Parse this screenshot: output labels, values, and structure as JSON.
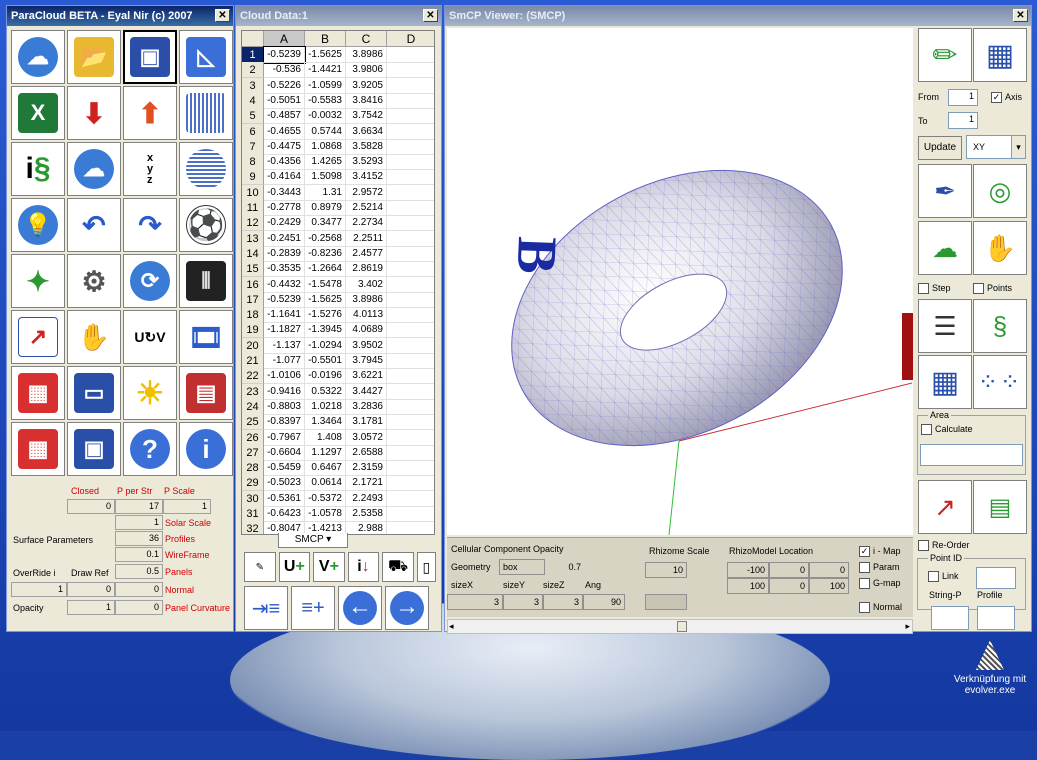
{
  "paracloud": {
    "title": "ParaCloud BETA  -  Eyal Nir (c) 2007",
    "params": {
      "closed_label": "Closed",
      "pperstr_label": "P per Str",
      "pscale_label": "P Scale",
      "closed_value": "0",
      "pperstr_value": "17",
      "pscale_value": "1",
      "surface_params_label": "Surface Parameters",
      "solar_scale_value": "1",
      "solar_scale_label": "Solar Scale",
      "profiles_value": "36",
      "profiles_label": "Profiles",
      "wireframe_value": "0.1",
      "wireframe_label": "WireFrame",
      "override_label": "OverRide i",
      "drawref_label": "Draw Ref",
      "panels_value": "0.5",
      "panels_label": "Panels",
      "override_value": "1",
      "drawref_value": "0",
      "normal_value": "0",
      "normal_label": "Normal",
      "opacity_label": "Opacity",
      "opacity_value": "1",
      "panelcurv_value": "0",
      "panelcurv_label": "Panel Curvature"
    }
  },
  "cloud": {
    "title": "Cloud Data:1",
    "columns": [
      "A",
      "B",
      "C",
      "D"
    ],
    "sheet_tab": "SMCP",
    "rows": [
      [
        "1",
        "-0.5239",
        "-1.5625",
        "3.8986"
      ],
      [
        "2",
        "-0.536",
        "-1.4421",
        "3.9806"
      ],
      [
        "3",
        "-0.5226",
        "-1.0599",
        "3.9205"
      ],
      [
        "4",
        "-0.5051",
        "-0.5583",
        "3.8416"
      ],
      [
        "5",
        "-0.4857",
        "-0.0032",
        "3.7542"
      ],
      [
        "6",
        "-0.4655",
        "0.5744",
        "3.6634"
      ],
      [
        "7",
        "-0.4475",
        "1.0868",
        "3.5828"
      ],
      [
        "8",
        "-0.4356",
        "1.4265",
        "3.5293"
      ],
      [
        "9",
        "-0.4164",
        "1.5098",
        "3.4152"
      ],
      [
        "10",
        "-0.3443",
        "1.31",
        "2.9572"
      ],
      [
        "11",
        "-0.2778",
        "0.8979",
        "2.5214"
      ],
      [
        "12",
        "-0.2429",
        "0.3477",
        "2.2734"
      ],
      [
        "13",
        "-0.2451",
        "-0.2568",
        "2.2511"
      ],
      [
        "14",
        "-0.2839",
        "-0.8236",
        "2.4577"
      ],
      [
        "15",
        "-0.3535",
        "-1.2664",
        "2.8619"
      ],
      [
        "16",
        "-0.4432",
        "-1.5478",
        "3.402"
      ],
      [
        "17",
        "-0.5239",
        "-1.5625",
        "3.8986"
      ],
      [
        "18",
        "-1.1641",
        "-1.5276",
        "4.0113"
      ],
      [
        "19",
        "-1.1827",
        "-1.3945",
        "4.0689"
      ],
      [
        "20",
        "-1.137",
        "-1.0294",
        "3.9502"
      ],
      [
        "21",
        "-1.077",
        "-0.5501",
        "3.7945"
      ],
      [
        "22",
        "-1.0106",
        "-0.0196",
        "3.6221"
      ],
      [
        "23",
        "-0.9416",
        "0.5322",
        "3.4427"
      ],
      [
        "24",
        "-0.8803",
        "1.0218",
        "3.2836"
      ],
      [
        "25",
        "-0.8397",
        "1.3464",
        "3.1781"
      ],
      [
        "26",
        "-0.7967",
        "1.408",
        "3.0572"
      ],
      [
        "27",
        "-0.6604",
        "1.1297",
        "2.6588"
      ],
      [
        "28",
        "-0.5459",
        "0.6467",
        "2.3159"
      ],
      [
        "29",
        "-0.5023",
        "0.0614",
        "2.1721"
      ],
      [
        "30",
        "-0.5361",
        "-0.5372",
        "2.2493"
      ],
      [
        "31",
        "-0.6423",
        "-1.0578",
        "2.5358"
      ],
      [
        "32",
        "-0.8047",
        "-1.4213",
        "2.988"
      ]
    ]
  },
  "viewer": {
    "title": "SmCP Viewer: (SMCP)",
    "axis_b": "B",
    "from_label": "From",
    "from_value": "1",
    "to_label": "To",
    "to_value": "1",
    "axis_label": "Axis",
    "update_label": "Update",
    "plane_value": "XY",
    "step_label": "Step",
    "points_label": "Points",
    "area_label": "Area",
    "calculate_label": "Calculate",
    "reorder_label": "Re-Order",
    "pointid_label": "Point ID",
    "link_label": "Link",
    "stringp_label": "String-P",
    "profile_label": "Profile",
    "imap_label": "i - Map",
    "param_label": "Param",
    "gmap_label": "G-map",
    "normal_label": "Normal",
    "opacity_label": "Cellular Component Opacity",
    "geometry_label": "Geometry",
    "geometry_value": "box",
    "opacity_value": "0.7",
    "rhizome_scale_label": "Rhizome Scale",
    "rhizome_scale_value": "10",
    "rhizo_loc_label": "RhizoModel Location",
    "loc_row1": [
      "-100",
      "0",
      "0"
    ],
    "loc_row2": [
      "100",
      "0",
      "100"
    ],
    "sizex_label": "sizeX",
    "sizey_label": "sizeY",
    "sizez_label": "sizeZ",
    "ang_label": "Ang",
    "sizex_value": "3",
    "sizey_value": "3",
    "sizez_value": "3",
    "ang_value": "90"
  },
  "desktop": {
    "shortcut_label": "Verknüpfung mit evolver.exe"
  }
}
